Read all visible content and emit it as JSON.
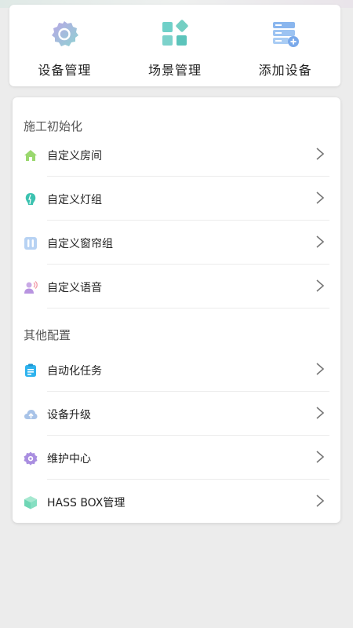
{
  "quick_actions": [
    {
      "label": "设备管理",
      "icon": "gear-icon"
    },
    {
      "label": "场景管理",
      "icon": "grid-blocks-icon"
    },
    {
      "label": "添加设备",
      "icon": "server-add-icon"
    }
  ],
  "sections": [
    {
      "title": "施工初始化",
      "items": [
        {
          "label": "自定义房间",
          "icon": "house-icon"
        },
        {
          "label": "自定义灯组",
          "icon": "bulb-icon"
        },
        {
          "label": "自定义窗帘组",
          "icon": "curtain-icon"
        },
        {
          "label": "自定义语音",
          "icon": "voice-person-icon"
        }
      ]
    },
    {
      "title": "其他配置",
      "items": [
        {
          "label": "自动化任务",
          "icon": "task-list-icon"
        },
        {
          "label": "设备升级",
          "icon": "cloud-upload-icon"
        },
        {
          "label": "维护中心",
          "icon": "maintenance-gear-icon"
        },
        {
          "label": "HASS BOX管理",
          "icon": "box-icon"
        }
      ]
    }
  ],
  "colors": {
    "background": "#ececec",
    "card": "#ffffff",
    "chevron": "#777777"
  }
}
